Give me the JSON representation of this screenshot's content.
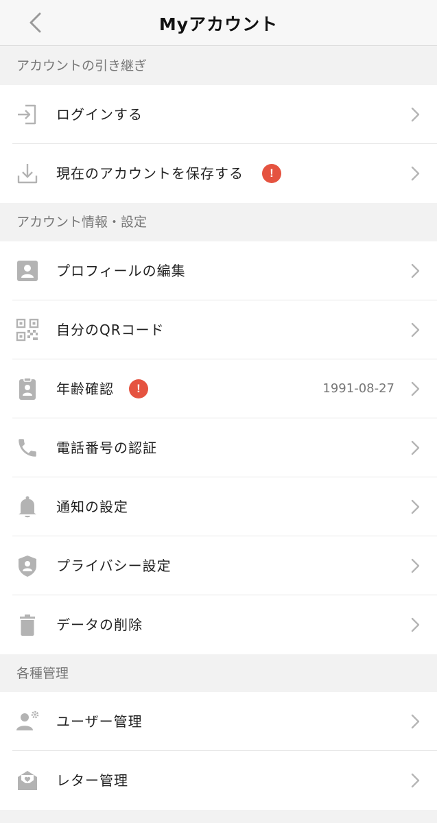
{
  "header": {
    "title": "Myアカウント"
  },
  "sections": [
    {
      "title": "アカウントの引き継ぎ",
      "items": [
        {
          "label": "ログインする"
        },
        {
          "label": "現在のアカウントを保存する",
          "alert": "!"
        }
      ]
    },
    {
      "title": "アカウント情報・設定",
      "items": [
        {
          "label": "プロフィールの編集"
        },
        {
          "label": "自分のQRコード"
        },
        {
          "label": "年齢確認",
          "alert": "!",
          "value": "1991-08-27"
        },
        {
          "label": "電話番号の認証"
        },
        {
          "label": "通知の設定"
        },
        {
          "label": "プライバシー設定"
        },
        {
          "label": "データの削除"
        }
      ]
    },
    {
      "title": "各種管理",
      "items": [
        {
          "label": "ユーザー管理"
        },
        {
          "label": "レター管理"
        }
      ]
    }
  ],
  "colors": {
    "alert": "#e55340",
    "icon": "#b3b3b3",
    "chevron": "#b5b5b5"
  }
}
